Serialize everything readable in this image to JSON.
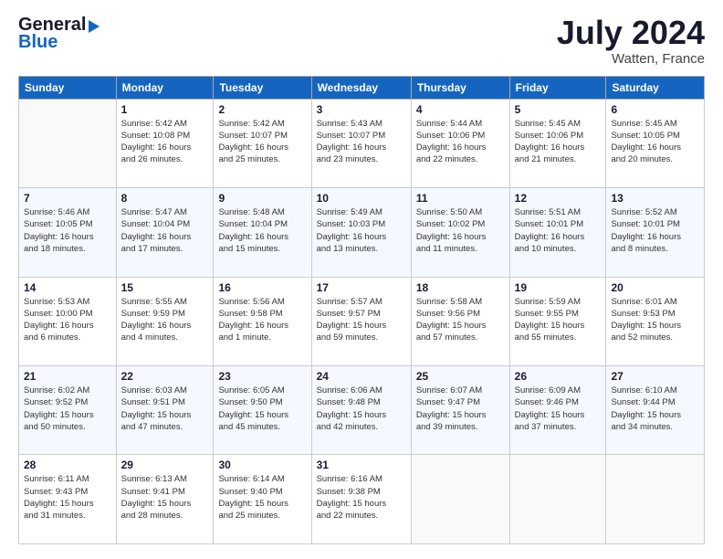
{
  "logo": {
    "line1": "General",
    "line2": "Blue",
    "arrow": "▶"
  },
  "title": "July 2024",
  "subtitle": "Watten, France",
  "headers": [
    "Sunday",
    "Monday",
    "Tuesday",
    "Wednesday",
    "Thursday",
    "Friday",
    "Saturday"
  ],
  "weeks": [
    [
      {
        "day": "",
        "info": ""
      },
      {
        "day": "1",
        "info": "Sunrise: 5:42 AM\nSunset: 10:08 PM\nDaylight: 16 hours\nand 26 minutes."
      },
      {
        "day": "2",
        "info": "Sunrise: 5:42 AM\nSunset: 10:07 PM\nDaylight: 16 hours\nand 25 minutes."
      },
      {
        "day": "3",
        "info": "Sunrise: 5:43 AM\nSunset: 10:07 PM\nDaylight: 16 hours\nand 23 minutes."
      },
      {
        "day": "4",
        "info": "Sunrise: 5:44 AM\nSunset: 10:06 PM\nDaylight: 16 hours\nand 22 minutes."
      },
      {
        "day": "5",
        "info": "Sunrise: 5:45 AM\nSunset: 10:06 PM\nDaylight: 16 hours\nand 21 minutes."
      },
      {
        "day": "6",
        "info": "Sunrise: 5:45 AM\nSunset: 10:05 PM\nDaylight: 16 hours\nand 20 minutes."
      }
    ],
    [
      {
        "day": "7",
        "info": "Sunrise: 5:46 AM\nSunset: 10:05 PM\nDaylight: 16 hours\nand 18 minutes."
      },
      {
        "day": "8",
        "info": "Sunrise: 5:47 AM\nSunset: 10:04 PM\nDaylight: 16 hours\nand 17 minutes."
      },
      {
        "day": "9",
        "info": "Sunrise: 5:48 AM\nSunset: 10:04 PM\nDaylight: 16 hours\nand 15 minutes."
      },
      {
        "day": "10",
        "info": "Sunrise: 5:49 AM\nSunset: 10:03 PM\nDaylight: 16 hours\nand 13 minutes."
      },
      {
        "day": "11",
        "info": "Sunrise: 5:50 AM\nSunset: 10:02 PM\nDaylight: 16 hours\nand 11 minutes."
      },
      {
        "day": "12",
        "info": "Sunrise: 5:51 AM\nSunset: 10:01 PM\nDaylight: 16 hours\nand 10 minutes."
      },
      {
        "day": "13",
        "info": "Sunrise: 5:52 AM\nSunset: 10:01 PM\nDaylight: 16 hours\nand 8 minutes."
      }
    ],
    [
      {
        "day": "14",
        "info": "Sunrise: 5:53 AM\nSunset: 10:00 PM\nDaylight: 16 hours\nand 6 minutes."
      },
      {
        "day": "15",
        "info": "Sunrise: 5:55 AM\nSunset: 9:59 PM\nDaylight: 16 hours\nand 4 minutes."
      },
      {
        "day": "16",
        "info": "Sunrise: 5:56 AM\nSunset: 9:58 PM\nDaylight: 16 hours\nand 1 minute."
      },
      {
        "day": "17",
        "info": "Sunrise: 5:57 AM\nSunset: 9:57 PM\nDaylight: 15 hours\nand 59 minutes."
      },
      {
        "day": "18",
        "info": "Sunrise: 5:58 AM\nSunset: 9:56 PM\nDaylight: 15 hours\nand 57 minutes."
      },
      {
        "day": "19",
        "info": "Sunrise: 5:59 AM\nSunset: 9:55 PM\nDaylight: 15 hours\nand 55 minutes."
      },
      {
        "day": "20",
        "info": "Sunrise: 6:01 AM\nSunset: 9:53 PM\nDaylight: 15 hours\nand 52 minutes."
      }
    ],
    [
      {
        "day": "21",
        "info": "Sunrise: 6:02 AM\nSunset: 9:52 PM\nDaylight: 15 hours\nand 50 minutes."
      },
      {
        "day": "22",
        "info": "Sunrise: 6:03 AM\nSunset: 9:51 PM\nDaylight: 15 hours\nand 47 minutes."
      },
      {
        "day": "23",
        "info": "Sunrise: 6:05 AM\nSunset: 9:50 PM\nDaylight: 15 hours\nand 45 minutes."
      },
      {
        "day": "24",
        "info": "Sunrise: 6:06 AM\nSunset: 9:48 PM\nDaylight: 15 hours\nand 42 minutes."
      },
      {
        "day": "25",
        "info": "Sunrise: 6:07 AM\nSunset: 9:47 PM\nDaylight: 15 hours\nand 39 minutes."
      },
      {
        "day": "26",
        "info": "Sunrise: 6:09 AM\nSunset: 9:46 PM\nDaylight: 15 hours\nand 37 minutes."
      },
      {
        "day": "27",
        "info": "Sunrise: 6:10 AM\nSunset: 9:44 PM\nDaylight: 15 hours\nand 34 minutes."
      }
    ],
    [
      {
        "day": "28",
        "info": "Sunrise: 6:11 AM\nSunset: 9:43 PM\nDaylight: 15 hours\nand 31 minutes."
      },
      {
        "day": "29",
        "info": "Sunrise: 6:13 AM\nSunset: 9:41 PM\nDaylight: 15 hours\nand 28 minutes."
      },
      {
        "day": "30",
        "info": "Sunrise: 6:14 AM\nSunset: 9:40 PM\nDaylight: 15 hours\nand 25 minutes."
      },
      {
        "day": "31",
        "info": "Sunrise: 6:16 AM\nSunset: 9:38 PM\nDaylight: 15 hours\nand 22 minutes."
      },
      {
        "day": "",
        "info": ""
      },
      {
        "day": "",
        "info": ""
      },
      {
        "day": "",
        "info": ""
      }
    ]
  ]
}
